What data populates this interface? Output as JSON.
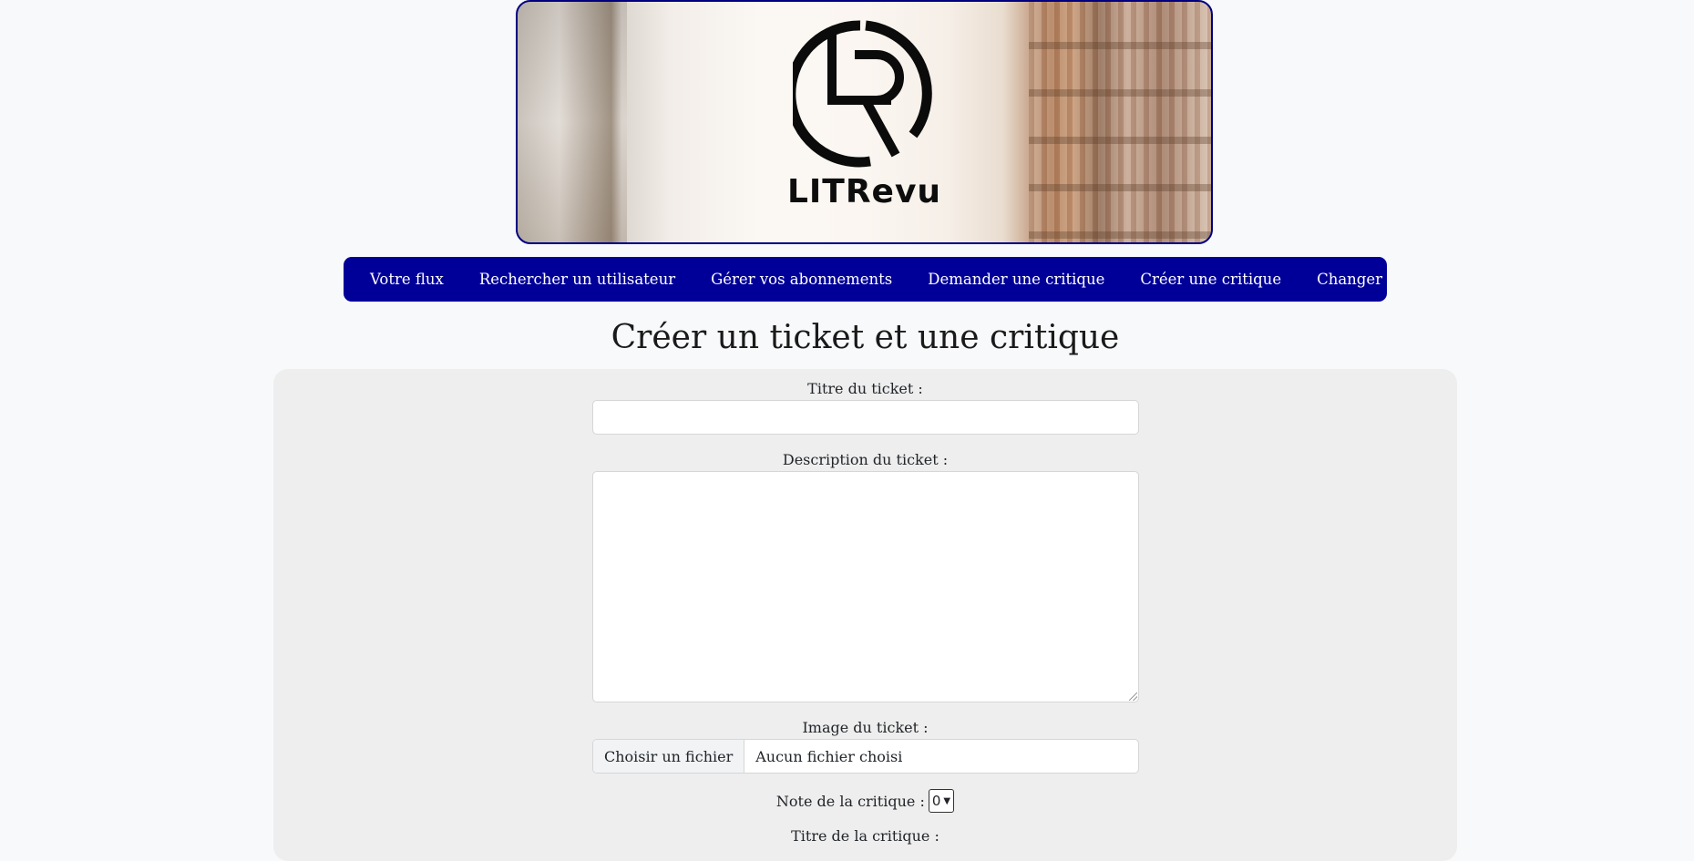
{
  "brand": {
    "name": "LITRevu",
    "logo_icon": "lr-circle-logo-icon"
  },
  "nav": {
    "items": [
      "Votre flux",
      "Rechercher un utilisateur",
      "Gérer vos abonnements",
      "Demander une critique",
      "Créer une critique",
      "Changer votre mot de passe"
    ],
    "background": "#000099"
  },
  "page": {
    "title": "Créer un ticket et une critique"
  },
  "form": {
    "ticket_title_label": "Titre du ticket :",
    "ticket_title_value": "",
    "ticket_description_label": "Description du ticket :",
    "ticket_description_value": "",
    "ticket_image_label": "Image du ticket :",
    "file_button_label": "Choisir un fichier",
    "file_status": "Aucun fichier choisi",
    "rating_label": "Note de la critique :",
    "rating_value": "0",
    "review_title_label": "Titre de la critique :"
  }
}
